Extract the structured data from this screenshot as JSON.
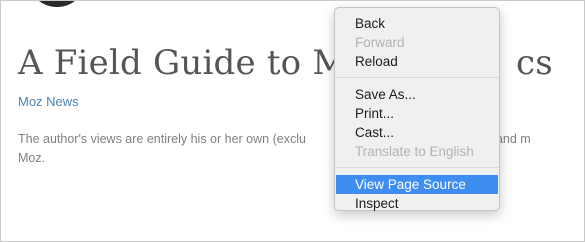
{
  "article": {
    "title": "A Field Guide to Mo",
    "title_tail": "cs",
    "category": "Moz News",
    "disclaimer_line1": "The author's views are entirely his or her own (exclu",
    "disclaimer_line1_tail": "ypnosis) and m",
    "disclaimer_line2": "Moz."
  },
  "context_menu": {
    "groups": [
      [
        {
          "label": "Back",
          "enabled": true
        },
        {
          "label": "Forward",
          "enabled": false
        },
        {
          "label": "Reload",
          "enabled": true
        }
      ],
      [
        {
          "label": "Save As...",
          "enabled": true
        },
        {
          "label": "Print...",
          "enabled": true
        },
        {
          "label": "Cast...",
          "enabled": true
        },
        {
          "label": "Translate to English",
          "enabled": false
        }
      ],
      [
        {
          "label": "View Page Source",
          "enabled": true,
          "selected": true
        },
        {
          "label": "Inspect",
          "enabled": true
        }
      ]
    ]
  },
  "colors": {
    "highlight": "#3e8ef2",
    "link": "#4a86b4"
  }
}
